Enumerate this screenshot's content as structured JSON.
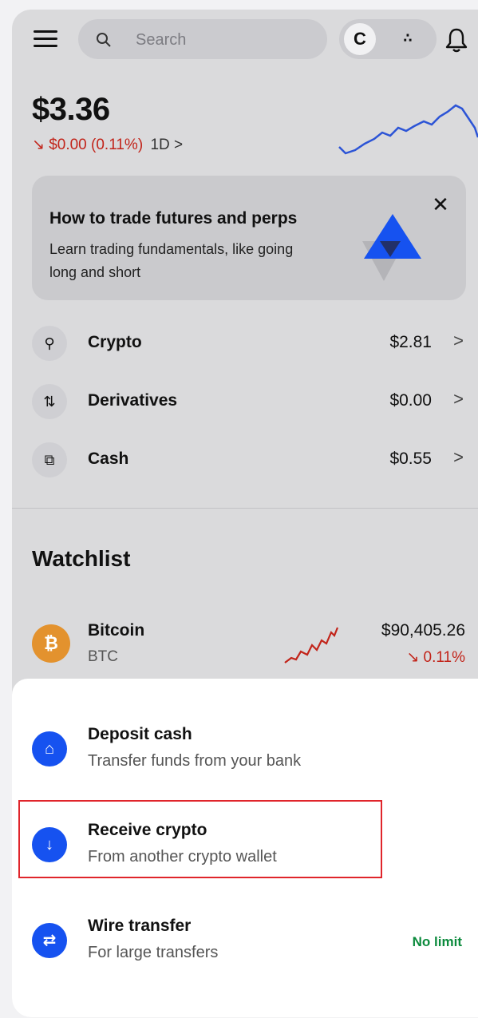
{
  "header": {
    "search_placeholder": "Search",
    "switch_label": "C",
    "advanced_label": "∴",
    "icons": [
      "menu-icon",
      "search-icon",
      "advanced-trade-icon",
      "bell-icon"
    ]
  },
  "portfolio": {
    "balance": "$3.36",
    "change": "↘ $0.00 (0.11%)",
    "period": "1D >",
    "accent_negative": "#c2241a"
  },
  "promo": {
    "title": "How to trade futures and perps",
    "body": "Learn trading fundamentals, like going long and short",
    "close_label": "✕"
  },
  "accounts": [
    {
      "name": "Crypto",
      "value": "$2.81",
      "icon": "crypto-icon",
      "chevron": ">"
    },
    {
      "name": "Derivatives",
      "value": "$0.00",
      "icon": "derivatives-icon",
      "chevron": ">"
    },
    {
      "name": "Cash",
      "value": "$0.55",
      "icon": "cash-icon",
      "chevron": ">"
    }
  ],
  "watchlist": {
    "title": "Watchlist",
    "items": [
      {
        "name": "Bitcoin",
        "symbol": "BTC",
        "price": "$90,405.26",
        "change": "↘ 0.11%",
        "coin_glyph": "₿"
      }
    ]
  },
  "sheet": {
    "options": [
      {
        "title": "Deposit cash",
        "subtitle": "Transfer funds from your bank",
        "icon": "bank-icon",
        "glyph": "⌂"
      },
      {
        "title": "Receive crypto",
        "subtitle": "From another crypto wallet",
        "icon": "arrow-down-icon",
        "glyph": "↓"
      },
      {
        "title": "Wire transfer",
        "subtitle": "For large transfers",
        "badge": "No limit",
        "icon": "transfer-icon",
        "glyph": "⇄"
      }
    ],
    "accent": "#1652f0",
    "badge_color": "#0b8a3c",
    "highlight_color": "#e0252b"
  }
}
